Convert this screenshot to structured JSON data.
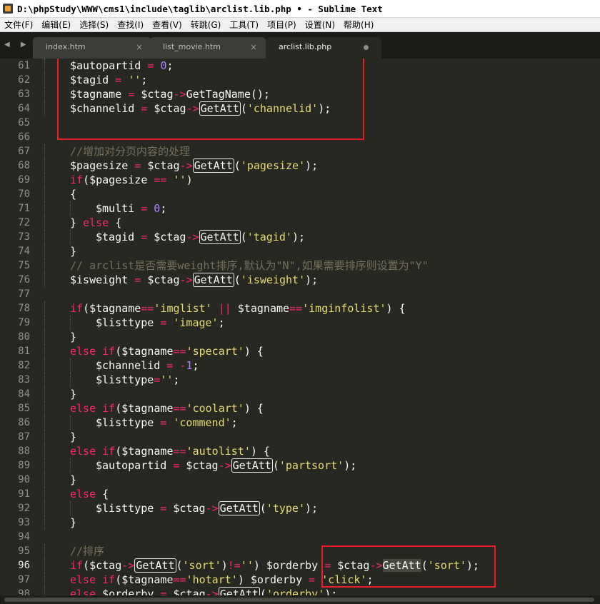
{
  "window": {
    "title": "D:\\phpStudy\\WWW\\cms1\\include\\taglib\\arclist.lib.php • - Sublime Text"
  },
  "menu": [
    "文件(F)",
    "编辑(E)",
    "选择(S)",
    "查找(I)",
    "查看(V)",
    "转跳(G)",
    "工具(T)",
    "项目(P)",
    "设置(N)",
    "帮助(H)"
  ],
  "tabs": [
    {
      "label": "index.htm",
      "close": "×"
    },
    {
      "label": "list_movie.htm",
      "close": "×"
    },
    {
      "label": "arclist.lib.php",
      "close": ""
    }
  ],
  "nav_arrows": "◀ ▶",
  "colors": {
    "background": "#272822",
    "keyword": "#f92672",
    "string": "#e6db74",
    "number": "#ae81ff",
    "comment": "#75715e",
    "highlight_box": "#e8202a"
  },
  "current_line": "96",
  "lines": [
    {
      "n": "61",
      "i": 1,
      "t": [
        [
          "v",
          "$autopartid"
        ],
        [
          "p",
          " "
        ],
        [
          "o",
          "="
        ],
        [
          "p",
          " "
        ],
        [
          "n",
          "0"
        ],
        [
          "p",
          ";"
        ]
      ]
    },
    {
      "n": "62",
      "i": 1,
      "t": [
        [
          "v",
          "$tagid"
        ],
        [
          "p",
          " "
        ],
        [
          "o",
          "="
        ],
        [
          "p",
          " "
        ],
        [
          "s",
          "''"
        ],
        [
          "p",
          ";"
        ]
      ]
    },
    {
      "n": "63",
      "i": 1,
      "t": [
        [
          "v",
          "$tagname"
        ],
        [
          "p",
          " "
        ],
        [
          "o",
          "="
        ],
        [
          "p",
          " $ctag"
        ],
        [
          "o",
          "->"
        ],
        [
          "p",
          "GetTagName();"
        ]
      ]
    },
    {
      "n": "64",
      "i": 1,
      "t": [
        [
          "v",
          "$channelid"
        ],
        [
          "p",
          " "
        ],
        [
          "o",
          "="
        ],
        [
          "p",
          " $ctag"
        ],
        [
          "o",
          "->"
        ],
        [
          "b",
          "GetAtt"
        ],
        [
          "p",
          "("
        ],
        [
          "s",
          "'channelid'"
        ],
        [
          "p",
          ");"
        ]
      ]
    },
    {
      "n": "65",
      "i": 0,
      "t": []
    },
    {
      "n": "66",
      "i": 0,
      "t": []
    },
    {
      "n": "67",
      "i": 1,
      "t": [
        [
          "c",
          "//增加对分页内容的处理"
        ]
      ]
    },
    {
      "n": "68",
      "i": 1,
      "t": [
        [
          "v",
          "$pagesize"
        ],
        [
          "p",
          " "
        ],
        [
          "o",
          "="
        ],
        [
          "p",
          " $ctag"
        ],
        [
          "o",
          "->"
        ],
        [
          "b",
          "GetAtt"
        ],
        [
          "p",
          "("
        ],
        [
          "s",
          "'pagesize'"
        ],
        [
          "p",
          ");"
        ]
      ]
    },
    {
      "n": "69",
      "i": 1,
      "t": [
        [
          "k",
          "if"
        ],
        [
          "p",
          "($pagesize "
        ],
        [
          "o",
          "=="
        ],
        [
          "p",
          " "
        ],
        [
          "s",
          "''"
        ],
        [
          "p",
          ")"
        ]
      ]
    },
    {
      "n": "70",
      "i": 1,
      "t": [
        [
          "p",
          "{"
        ]
      ]
    },
    {
      "n": "71",
      "i": 2,
      "t": [
        [
          "v",
          "$multi"
        ],
        [
          "p",
          " "
        ],
        [
          "o",
          "="
        ],
        [
          "p",
          " "
        ],
        [
          "n",
          "0"
        ],
        [
          "p",
          ";"
        ]
      ]
    },
    {
      "n": "72",
      "i": 1,
      "t": [
        [
          "p",
          "} "
        ],
        [
          "k",
          "else"
        ],
        [
          "p",
          " {"
        ]
      ]
    },
    {
      "n": "73",
      "i": 2,
      "t": [
        [
          "v",
          "$tagid"
        ],
        [
          "p",
          " "
        ],
        [
          "o",
          "="
        ],
        [
          "p",
          " $ctag"
        ],
        [
          "o",
          "->"
        ],
        [
          "b",
          "GetAtt"
        ],
        [
          "p",
          "("
        ],
        [
          "s",
          "'tagid'"
        ],
        [
          "p",
          ");"
        ]
      ]
    },
    {
      "n": "74",
      "i": 1,
      "t": [
        [
          "p",
          "}"
        ]
      ]
    },
    {
      "n": "75",
      "i": 1,
      "t": [
        [
          "c",
          "// arclist是否需要weight排序,默认为\"N\",如果需要排序则设置为\"Y\""
        ]
      ]
    },
    {
      "n": "76",
      "i": 1,
      "t": [
        [
          "v",
          "$isweight"
        ],
        [
          "p",
          " "
        ],
        [
          "o",
          "="
        ],
        [
          "p",
          " $ctag"
        ],
        [
          "o",
          "->"
        ],
        [
          "b",
          "GetAtt"
        ],
        [
          "p",
          "("
        ],
        [
          "s",
          "'isweight'"
        ],
        [
          "p",
          ");"
        ]
      ]
    },
    {
      "n": "77",
      "i": 0,
      "t": []
    },
    {
      "n": "78",
      "i": 1,
      "t": [
        [
          "k",
          "if"
        ],
        [
          "p",
          "($tagname"
        ],
        [
          "o",
          "=="
        ],
        [
          "s",
          "'imglist'"
        ],
        [
          "p",
          " "
        ],
        [
          "o",
          "||"
        ],
        [
          "p",
          " $tagname"
        ],
        [
          "o",
          "=="
        ],
        [
          "s",
          "'imginfolist'"
        ],
        [
          "p",
          ") {"
        ]
      ]
    },
    {
      "n": "79",
      "i": 2,
      "t": [
        [
          "v",
          "$listtype"
        ],
        [
          "p",
          " "
        ],
        [
          "o",
          "="
        ],
        [
          "p",
          " "
        ],
        [
          "s",
          "'image'"
        ],
        [
          "p",
          ";"
        ]
      ]
    },
    {
      "n": "80",
      "i": 1,
      "t": [
        [
          "p",
          "}"
        ]
      ]
    },
    {
      "n": "81",
      "i": 1,
      "t": [
        [
          "k",
          "else"
        ],
        [
          "p",
          " "
        ],
        [
          "k",
          "if"
        ],
        [
          "p",
          "($tagname"
        ],
        [
          "o",
          "=="
        ],
        [
          "s",
          "'specart'"
        ],
        [
          "p",
          ") {"
        ]
      ]
    },
    {
      "n": "82",
      "i": 2,
      "t": [
        [
          "v",
          "$channelid"
        ],
        [
          "p",
          " "
        ],
        [
          "o",
          "="
        ],
        [
          "p",
          " "
        ],
        [
          "o",
          "-"
        ],
        [
          "n",
          "1"
        ],
        [
          "p",
          ";"
        ]
      ]
    },
    {
      "n": "83",
      "i": 2,
      "t": [
        [
          "v",
          "$listtype"
        ],
        [
          "o",
          "="
        ],
        [
          "s",
          "''"
        ],
        [
          "p",
          ";"
        ]
      ]
    },
    {
      "n": "84",
      "i": 1,
      "t": [
        [
          "p",
          "}"
        ]
      ]
    },
    {
      "n": "85",
      "i": 1,
      "t": [
        [
          "k",
          "else"
        ],
        [
          "p",
          " "
        ],
        [
          "k",
          "if"
        ],
        [
          "p",
          "($tagname"
        ],
        [
          "o",
          "=="
        ],
        [
          "s",
          "'coolart'"
        ],
        [
          "p",
          ") {"
        ]
      ]
    },
    {
      "n": "86",
      "i": 2,
      "t": [
        [
          "v",
          "$listtype"
        ],
        [
          "p",
          " "
        ],
        [
          "o",
          "="
        ],
        [
          "p",
          " "
        ],
        [
          "s",
          "'commend'"
        ],
        [
          "p",
          ";"
        ]
      ]
    },
    {
      "n": "87",
      "i": 1,
      "t": [
        [
          "p",
          "}"
        ]
      ]
    },
    {
      "n": "88",
      "i": 1,
      "t": [
        [
          "k",
          "else"
        ],
        [
          "p",
          " "
        ],
        [
          "k",
          "if"
        ],
        [
          "p",
          "($tagname"
        ],
        [
          "o",
          "=="
        ],
        [
          "s",
          "'autolist'"
        ],
        [
          "p",
          ") {"
        ]
      ]
    },
    {
      "n": "89",
      "i": 2,
      "t": [
        [
          "v",
          "$autopartid"
        ],
        [
          "p",
          " "
        ],
        [
          "o",
          "="
        ],
        [
          "p",
          " $ctag"
        ],
        [
          "o",
          "->"
        ],
        [
          "b",
          "GetAtt"
        ],
        [
          "p",
          "("
        ],
        [
          "s",
          "'partsort'"
        ],
        [
          "p",
          ");"
        ]
      ]
    },
    {
      "n": "90",
      "i": 1,
      "t": [
        [
          "p",
          "}"
        ]
      ]
    },
    {
      "n": "91",
      "i": 1,
      "t": [
        [
          "k",
          "else"
        ],
        [
          "p",
          " {"
        ]
      ]
    },
    {
      "n": "92",
      "i": 2,
      "t": [
        [
          "v",
          "$listtype"
        ],
        [
          "p",
          " "
        ],
        [
          "o",
          "="
        ],
        [
          "p",
          " $ctag"
        ],
        [
          "o",
          "->"
        ],
        [
          "b",
          "GetAtt"
        ],
        [
          "p",
          "("
        ],
        [
          "s",
          "'type'"
        ],
        [
          "p",
          ");"
        ]
      ]
    },
    {
      "n": "93",
      "i": 1,
      "t": [
        [
          "p",
          "}"
        ]
      ]
    },
    {
      "n": "94",
      "i": 0,
      "t": []
    },
    {
      "n": "95",
      "i": 1,
      "t": [
        [
          "c",
          "//排序"
        ]
      ]
    },
    {
      "n": "96",
      "i": 1,
      "t": [
        [
          "k",
          "if"
        ],
        [
          "p",
          "($ctag"
        ],
        [
          "o",
          "->"
        ],
        [
          "b",
          "GetAtt"
        ],
        [
          "p",
          "("
        ],
        [
          "s",
          "'sort'"
        ],
        [
          "p",
          ")"
        ],
        [
          "o",
          "!="
        ],
        [
          "s",
          "''"
        ],
        [
          "p",
          ") $orderby "
        ],
        [
          "o",
          "="
        ],
        [
          "p",
          " $ctag"
        ],
        [
          "o",
          "->"
        ],
        [
          "g",
          "GetAtt"
        ],
        [
          "p",
          "("
        ],
        [
          "s",
          "'sort'"
        ],
        [
          "p",
          ");"
        ]
      ]
    },
    {
      "n": "97",
      "i": 1,
      "t": [
        [
          "k",
          "else"
        ],
        [
          "p",
          " "
        ],
        [
          "k",
          "if"
        ],
        [
          "p",
          "($tagname"
        ],
        [
          "o",
          "=="
        ],
        [
          "s",
          "'hotart'"
        ],
        [
          "p",
          ") $orderby "
        ],
        [
          "o",
          "="
        ],
        [
          "p",
          " "
        ],
        [
          "s",
          "'click'"
        ],
        [
          "p",
          ";"
        ]
      ]
    },
    {
      "n": "98",
      "i": 1,
      "t": [
        [
          "k",
          "else"
        ],
        [
          "p",
          " $orderby "
        ],
        [
          "o",
          "="
        ],
        [
          "p",
          " $ctag"
        ],
        [
          "o",
          "->"
        ],
        [
          "b",
          "GetAtt"
        ],
        [
          "p",
          "("
        ],
        [
          "s",
          "'orderby'"
        ],
        [
          "p",
          ");"
        ]
      ]
    }
  ]
}
